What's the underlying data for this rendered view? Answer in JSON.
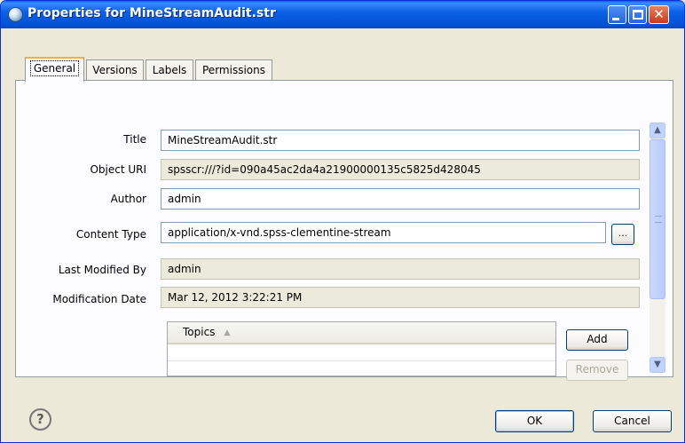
{
  "window": {
    "title": "Properties for MineStreamAudit.str",
    "icon": "app-globe-icon",
    "close_glyph": "✕"
  },
  "tabs": [
    {
      "label": "General",
      "active": true
    },
    {
      "label": "Versions",
      "active": false
    },
    {
      "label": "Labels",
      "active": false
    },
    {
      "label": "Permissions",
      "active": false
    }
  ],
  "general": {
    "fields": [
      {
        "label": "Title",
        "value": "MineStreamAudit.str",
        "readonly": false
      },
      {
        "label": "Object URI",
        "value": "spsscr:///?id=090a45ac2da4a21900000135c5825d428045",
        "readonly": true
      },
      {
        "label": "Author",
        "value": "admin",
        "readonly": false
      },
      {
        "label": "Content Type",
        "value": "application/x-vnd.spss-clementine-stream",
        "readonly": false
      },
      {
        "label": "Last Modified By",
        "value": "admin",
        "readonly": true
      },
      {
        "label": "Modification Date",
        "value": "Mar 12, 2012 3:22:21 PM",
        "readonly": true
      }
    ],
    "browse_label": "...",
    "topics": {
      "column_header": "Topics",
      "add_label": "Add",
      "remove_label": "Remove"
    }
  },
  "footer": {
    "help_glyph": "?",
    "ok_label": "OK",
    "cancel_label": "Cancel"
  },
  "colors": {
    "titlebar": "#0352d6",
    "active_tab_accent": "#f8b439",
    "dialog_bg": "#ece9d8"
  }
}
